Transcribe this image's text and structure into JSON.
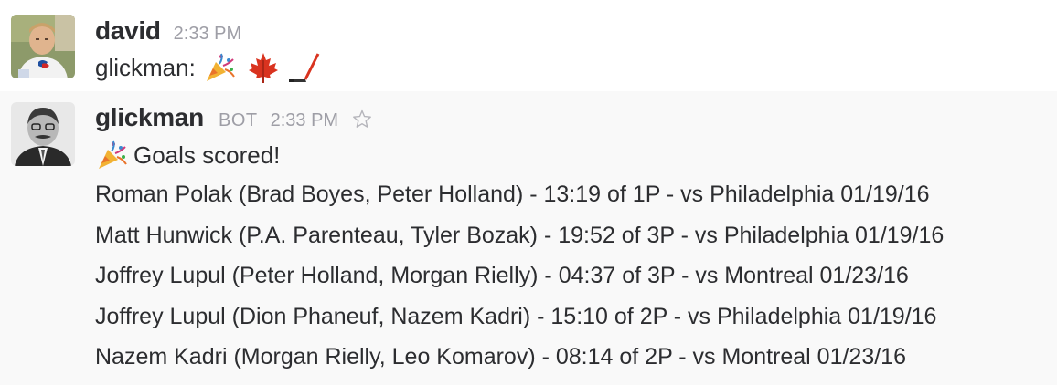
{
  "messages": [
    {
      "sender": "david",
      "time": "2:33 PM",
      "prefix": "glickman:",
      "emojis": [
        "party-popper",
        "maple-leaf",
        "hockey-stick"
      ]
    },
    {
      "sender": "glickman",
      "tag": "BOT",
      "time": "2:33 PM",
      "headline": "Goals scored!",
      "headline_emoji": "party-popper",
      "goals": [
        "Roman Polak (Brad Boyes, Peter Holland) - 13:19 of 1P - vs Philadelphia 01/19/16",
        "Matt Hunwick (P.A. Parenteau, Tyler Bozak) - 19:52 of 3P - vs Philadelphia 01/19/16",
        "Joffrey Lupul (Peter Holland, Morgan Rielly) - 04:37 of 3P - vs Montreal 01/23/16",
        "Joffrey Lupul (Dion Phaneuf, Nazem Kadri) - 15:10 of 2P - vs Philadelphia 01/19/16",
        "Nazem Kadri (Morgan Rielly, Leo Komarov) - 08:14 of 2P - vs Montreal 01/23/16"
      ]
    }
  ],
  "icons": {
    "star": "star-icon"
  },
  "colors": {
    "text": "#2c2d30",
    "muted": "#9e9ea6",
    "bot_bg": "#f9f9f9"
  }
}
